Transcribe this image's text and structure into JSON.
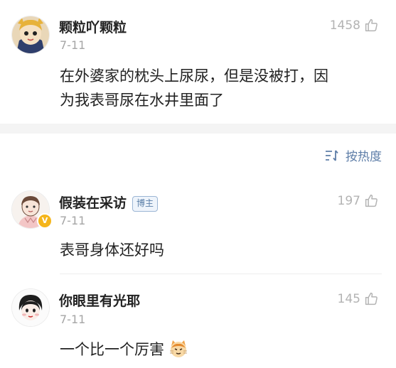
{
  "comments": [
    {
      "username": "颗粒吖颗粒",
      "date": "7-11",
      "likes": "1458",
      "lines": [
        "在外婆家的枕头上尿尿，但是没被打，因",
        "为我表哥尿在水井里面了"
      ]
    },
    {
      "username": "假装在采访",
      "badge": "博主",
      "verified": "V",
      "date": "7-11",
      "likes": "197",
      "text": "表哥身体还好吗"
    },
    {
      "username": "你眼里有光耶",
      "date": "7-11",
      "likes": "145",
      "text": "一个比一个厉害"
    }
  ],
  "sort": {
    "label": "按热度"
  },
  "icons": {
    "like": "thumbs-up-icon",
    "sort": "sort-icon",
    "emoji": "cat-face-emoji"
  },
  "colors": {
    "link_blue": "#5e7ea8",
    "muted_gray": "#a6a6a6",
    "verified_gold": "#f5b51b"
  }
}
